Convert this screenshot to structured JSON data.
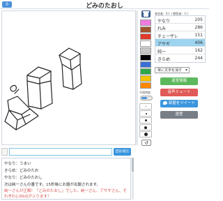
{
  "header": {
    "menu_label": "0",
    "title": "どみのたおし"
  },
  "palette": {
    "colors": [
      "#f07be0",
      "#a0522d",
      "#e03a2a",
      "#ffffff",
      "#c8c8c8",
      "#000000",
      "#3b6fd6",
      "#2ea84a",
      "#f5c400",
      "#ff8800",
      "#ffffff"
    ],
    "tools_label": "不透明度"
  },
  "scores": {
    "header": "参加者：6人 / 観覧者：1人",
    "rows": [
      {
        "name": "やなり",
        "points": "205",
        "active": false
      },
      {
        "name": "れみ",
        "points": "286",
        "active": false
      },
      {
        "name": "チェーザレ",
        "points": "151",
        "active": false
      },
      {
        "name": "アサギ",
        "points": "406",
        "active": true
      },
      {
        "name": "純一",
        "points": "162",
        "active": false
      },
      {
        "name": "きらめ",
        "points": "244",
        "active": false
      }
    ]
  },
  "controls": {
    "select_value": "常に文字を消す",
    "button_green": "退室情報",
    "button_red": "音声ミュート",
    "button_blue": "部屋をツイート",
    "button_gray": "退室"
  },
  "chat": {
    "input_value": "",
    "send_label": "回答/発言",
    "messages": [
      {
        "text": "やなり：うまい",
        "style": "sys"
      },
      {
        "text": "きらめ：どみのたお",
        "style": "sys"
      },
      {
        "text": "やなり：どみのたおし",
        "style": "sys"
      },
      {
        "text": "次は純一さんの番です。15秒後にお題が出題されます。",
        "style": "sys"
      },
      {
        "text": "純一さんが正解！「どみのたおし」でした。純一さん、アサギさん、それぞれに89点が入ります！",
        "style": "red"
      }
    ]
  }
}
